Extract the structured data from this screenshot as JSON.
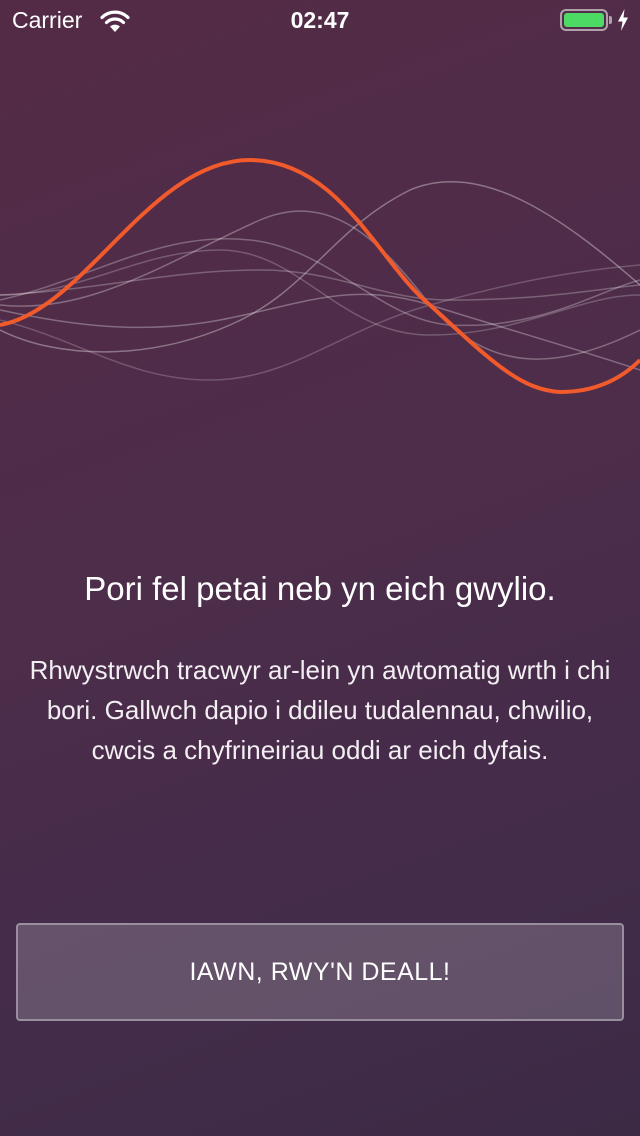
{
  "status_bar": {
    "carrier": "Carrier",
    "time": "02:47",
    "battery_level": 1.0,
    "battery_color": "#4cd964",
    "icons": [
      "wifi-icon",
      "battery-icon",
      "charging-bolt-icon"
    ]
  },
  "illustration": {
    "name": "sound-wave-illustration",
    "accent_color": "#f15a2b"
  },
  "onboarding": {
    "title": "Pori fel petai neb yn eich gwylio.",
    "description": "Rhwystrwch tracwyr ar-lein yn awtomatig wrth i chi bori. Gallwch dapio i ddileu tudalennau, chwilio, cwcis a chyfrineiriau oddi ar eich dyfais.",
    "confirm_button_label": "IAWN, RWY'N DEALL!"
  }
}
